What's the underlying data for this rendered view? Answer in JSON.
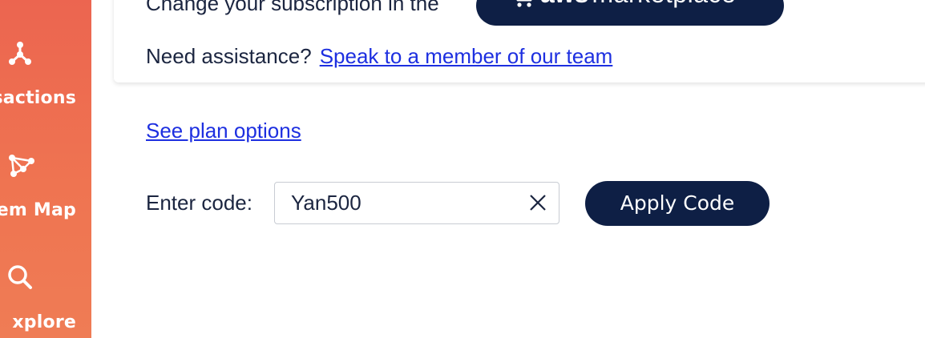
{
  "sidebar": {
    "items": [
      {
        "label": "nsactions",
        "icon": "transactions-icon"
      },
      {
        "label": "tem Map",
        "icon": "system-map-icon"
      },
      {
        "label": "xplore",
        "icon": "search-icon"
      }
    ]
  },
  "subscription": {
    "text": "Change your subscription in the",
    "aws_word": "aws",
    "marketplace_word": "marketplace"
  },
  "assistance": {
    "prompt": "Need assistance?",
    "link_text": "Speak to a member of our team"
  },
  "plan_link": "See plan options",
  "code_form": {
    "label": "Enter code:",
    "value": "Yan500",
    "apply_label": "Apply Code"
  },
  "colors": {
    "sidebar_top": "#ec6550",
    "sidebar_bottom": "#ef7c55",
    "navy": "#0e1f45",
    "link": "#1d2fe0",
    "text": "#1b2540"
  }
}
